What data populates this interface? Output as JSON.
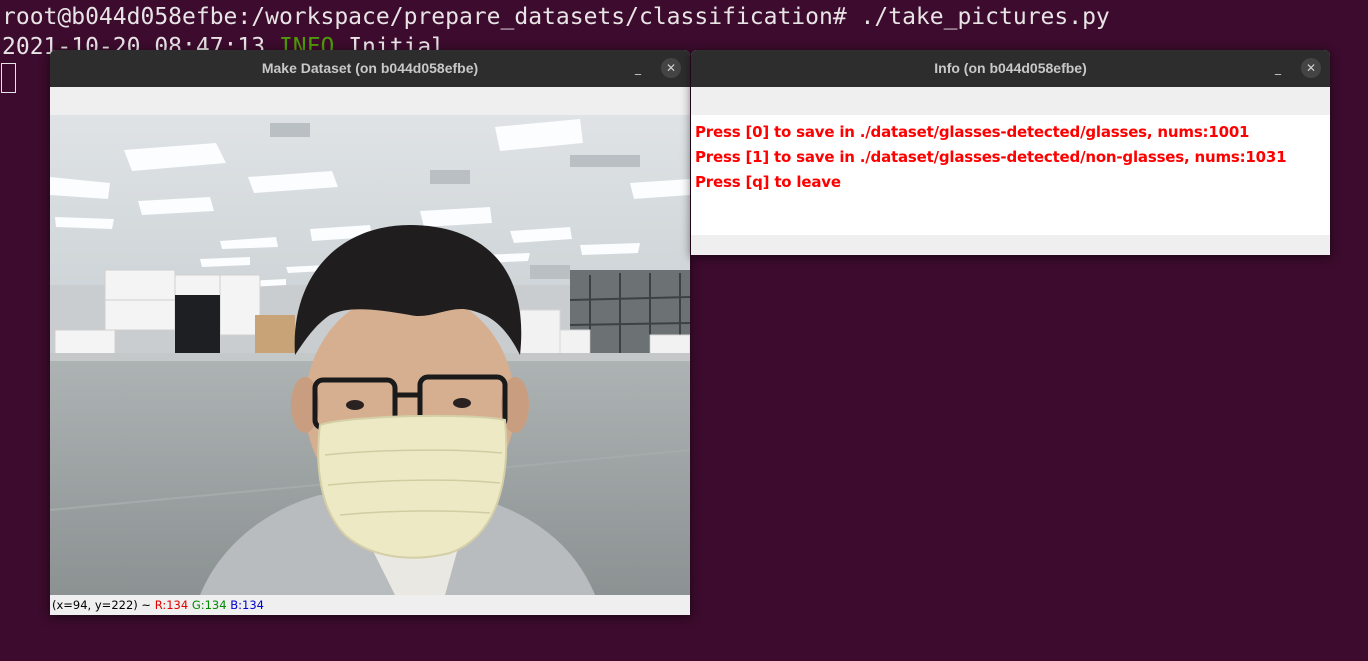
{
  "terminal": {
    "line1": "root@b044d058efbe:/workspace/prepare_datasets/classification# ./take_pictures.py",
    "line2_prefix": "2021-10-20 08:47:13 ",
    "line2_level": "INFO",
    "line2_msg": " Initial"
  },
  "windows": {
    "dataset": {
      "title": "Make Dataset (on b044d058efbe)",
      "minimize_glyph": "_",
      "close_glyph": "✕",
      "status": {
        "coords": "(x=94, y=222) ~ ",
        "r": "R:134",
        "g": "G:134",
        "b": "B:134"
      }
    },
    "info": {
      "title": "Info (on b044d058efbe)",
      "minimize_glyph": "_",
      "close_glyph": "✕",
      "lines": [
        "Press [0] to save in ./dataset/glasses-detected/glasses, nums:1001",
        "Press [1] to save in ./dataset/glasses-detected/non-glasses, nums:1031",
        "Press [q] to leave"
      ]
    }
  },
  "colors": {
    "desktop": "#3c0b2d",
    "terminal_info": "#4e9a06",
    "info_text": "#ff0000",
    "titlebar": "#2d2d2d"
  }
}
